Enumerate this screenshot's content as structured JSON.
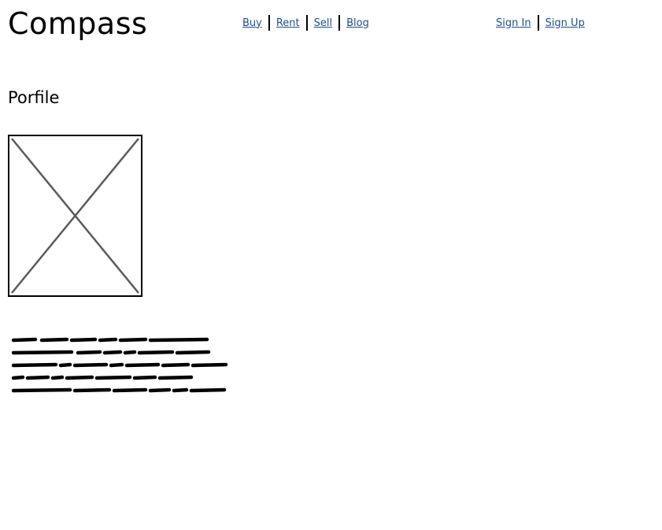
{
  "header": {
    "logo": "Compass",
    "nav": [
      {
        "label": "Buy"
      },
      {
        "label": "Rent"
      },
      {
        "label": "Sell"
      },
      {
        "label": "Blog"
      }
    ],
    "auth": [
      {
        "label": "Sign In"
      },
      {
        "label": "Sign Up"
      }
    ]
  },
  "main": {
    "title": "Porfile",
    "image": {
      "icon": "image-placeholder-icon"
    },
    "text_block": {
      "lines": 5,
      "icon": "scribble-text"
    }
  },
  "colors": {
    "link": "#1f4e8c",
    "text": "#000000",
    "placeholder_stroke": "#5a5a5a"
  }
}
